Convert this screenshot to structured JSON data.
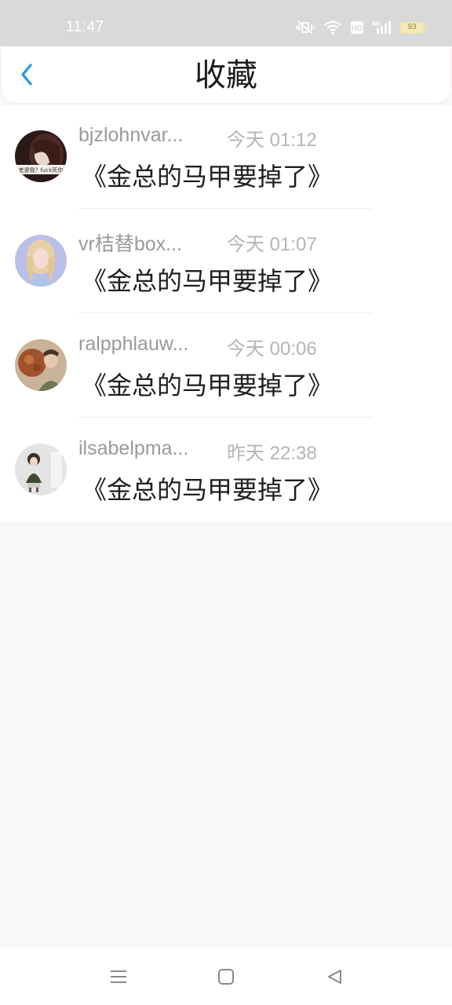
{
  "status_bar": {
    "time": "11:47",
    "battery_level": "93",
    "icons": [
      "vibrate-mute-icon",
      "wifi-icon",
      "hd-icon",
      "4g-signal-icon",
      "battery-icon"
    ]
  },
  "header": {
    "title": "收藏",
    "back_icon": "chevron-left-icon",
    "accent_color": "#2196e8"
  },
  "favorites": [
    {
      "username": "bjzlohnvar...",
      "time": "今天 01:12",
      "title": "《金总的马甲要掉了》",
      "avatar_caption": "老婆我？fuck死你"
    },
    {
      "username": "vr桔替box...",
      "time": "今天 01:07",
      "title": "《金总的马甲要掉了》"
    },
    {
      "username": "ralpphlauw...",
      "time": "今天 00:06",
      "title": "《金总的马甲要掉了》"
    },
    {
      "username": "ilsabelpma...",
      "time": "昨天 22:38",
      "title": "《金总的马甲要掉了》"
    }
  ],
  "nav_bar": {
    "buttons": [
      "menu-icon",
      "home-square-icon",
      "back-triangle-icon"
    ]
  }
}
